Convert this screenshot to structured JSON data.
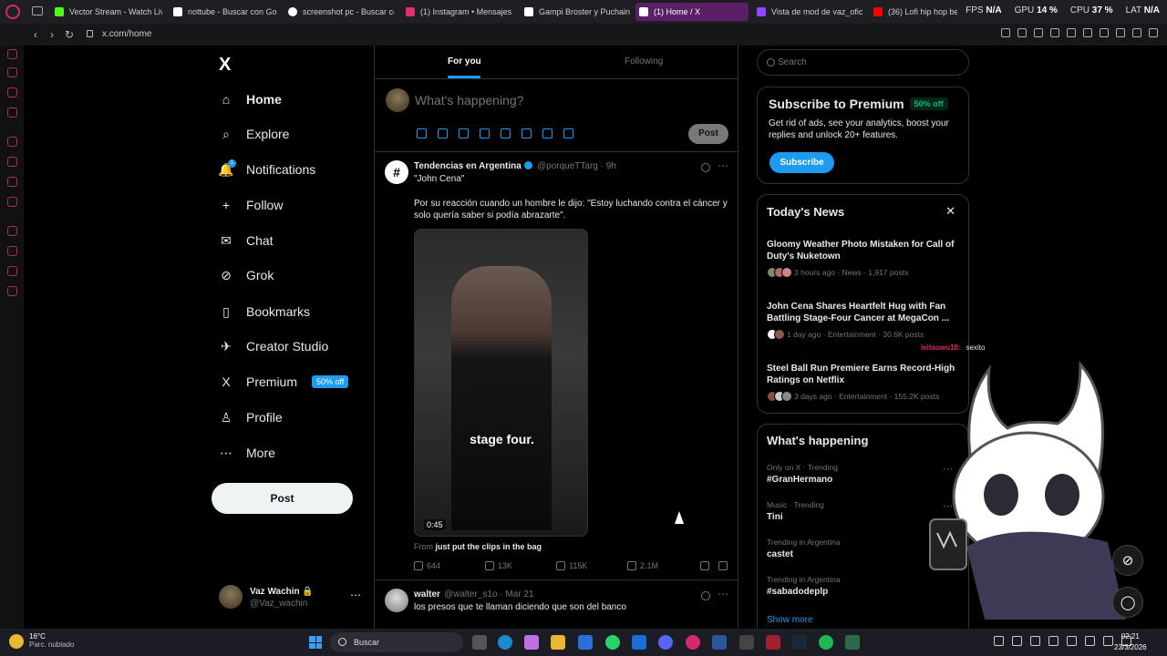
{
  "browser": {
    "tabs": [
      {
        "title": "Vector Stream - Watch Liv",
        "color": "#53fc18"
      },
      {
        "title": "nottube - Buscar con Goo",
        "color": "#ffffff"
      },
      {
        "title": "screenshot pc - Buscar co",
        "color": "#ffffff"
      },
      {
        "title": "(1) Instagram • Mensajes",
        "color": "#e1306c"
      },
      {
        "title": "Gampi Broster y Puchaina",
        "color": "#ffffff"
      },
      {
        "title": "(1) Home / X",
        "color": "#ffffff"
      },
      {
        "title": "Vista de mod de vaz_oficia",
        "color": "#9146ff"
      },
      {
        "title": "(36) Lofi hip hop beats Ro",
        "color": "#ff0000"
      }
    ],
    "stats": {
      "fps_label": "FPS",
      "fps": "N/A",
      "gpu_label": "GPU",
      "gpu": "14 %",
      "cpu_label": "CPU",
      "cpu": "37 %",
      "lat_label": "LAT",
      "lat": "N/A"
    },
    "url": "x.com/home",
    "nav": {
      "back": "‹",
      "forward": "›",
      "reload": "↻"
    }
  },
  "nav": {
    "logo": "X",
    "items": [
      {
        "label": "Home",
        "icon": "⌂"
      },
      {
        "label": "Explore",
        "icon": "⌕"
      },
      {
        "label": "Notifications",
        "icon": "🔔"
      },
      {
        "label": "Follow",
        "icon": "+"
      },
      {
        "label": "Chat",
        "icon": "✉"
      },
      {
        "label": "Grok",
        "icon": "⊘"
      },
      {
        "label": "Bookmarks",
        "icon": "▯"
      },
      {
        "label": "Creator Studio",
        "icon": "✈"
      },
      {
        "label": "Premium",
        "icon": "X"
      },
      {
        "label": "Profile",
        "icon": "♙"
      },
      {
        "label": "More",
        "icon": "⋯"
      }
    ],
    "notif_count": "1",
    "premium_badge": "50% off",
    "post_button": "Post",
    "profile": {
      "name": "Vaz Wachin 🔒",
      "handle": "@Vaz_wachin",
      "more": "⋯"
    }
  },
  "feed": {
    "tabs": [
      "For you",
      "Following"
    ],
    "composer": {
      "placeholder": "What's happening?",
      "post": "Post"
    },
    "tweets": [
      {
        "avatar": "#",
        "name": "Tendencias en Argentina",
        "handle": "@porqueTTarg · 9h",
        "quote": "\"John Cena\"",
        "text": "Por su reacción cuando un hombre le dijo: \"Estoy luchando contra el cáncer y solo quería saber si podía abrazarte\".",
        "media_caption": "stage four.",
        "media_duration": "0:45",
        "from_prefix": "From",
        "from_source": "just put the clips in the bag",
        "replies": "644",
        "reposts": "13K",
        "likes": "115K",
        "views": "2.1M"
      },
      {
        "name": "walter",
        "handle": "@walter_s1o · Mar 21",
        "text": "los presos que te llaman diciendo que son del banco"
      }
    ]
  },
  "sidebar": {
    "search_placeholder": "Search",
    "premium": {
      "title": "Subscribe to Premium",
      "badge": "50% off",
      "desc": "Get rid of ads, see your analytics, boost your replies and unlock 20+ features.",
      "button": "Subscribe"
    },
    "news": {
      "title": "Today's News",
      "close": "✕",
      "items": [
        {
          "headline": "Gloomy Weather Photo Mistaken for Call of Duty's Nuketown",
          "meta": "3 hours ago · News · 1,917 posts"
        },
        {
          "headline": "John Cena Shares Heartfelt Hug with Fan Battling Stage-Four Cancer at MegaCon ...",
          "meta": "1 day ago · Entertainment · 30.6K posts"
        },
        {
          "headline": "Steel Ball Run Premiere Earns Record-High Ratings on Netflix",
          "meta": "3 days ago · Entertainment · 155.2K posts"
        }
      ]
    },
    "happening": {
      "title": "What's happening",
      "trends": [
        {
          "context": "Only on X · Trending",
          "name": "#GranHermano"
        },
        {
          "context": "Music · Trending",
          "name": "Tini"
        },
        {
          "context": "Trending in Argentina",
          "name": "castet"
        },
        {
          "context": "Trending in Argentina",
          "name": "#sabadodeplp"
        }
      ],
      "show_more": "Show more"
    }
  },
  "overlay": {
    "user": "leitauwu18:",
    "message": "sexito"
  },
  "taskbar": {
    "temp": "16°C",
    "weather": "Parc. nublado",
    "search": "Buscar",
    "time": "02:21",
    "date": "23/3/2026"
  }
}
